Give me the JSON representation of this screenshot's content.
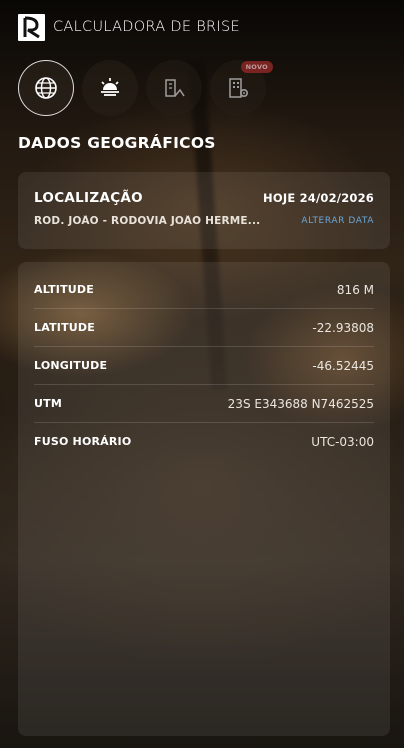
{
  "header": {
    "app_title": "CALCULADORA DE BRISE",
    "logo_icon": "brand-logo-icon"
  },
  "tabs": [
    {
      "name": "dados-geograficos",
      "icon": "globe-icon",
      "active": true
    },
    {
      "name": "sol",
      "icon": "sunrise-icon",
      "active": false
    },
    {
      "name": "fachada",
      "icon": "building-sun-icon",
      "active": false
    },
    {
      "name": "predio",
      "icon": "building-gear-icon",
      "active": false,
      "badge": "NOVO"
    }
  ],
  "section": {
    "title": "DADOS GEOGRÁFICOS"
  },
  "location": {
    "title": "LOCALIZAÇÃO",
    "date": "HOJE 24/02/2026",
    "address": "ROD. JOÃO - RODOVIA JOÃO HERME...",
    "change_date_link": "ALTERAR DATA"
  },
  "geo_data": {
    "rows": [
      {
        "label": "ALTITUDE",
        "value": "816 M"
      },
      {
        "label": "LATITUDE",
        "value": "-22.93808"
      },
      {
        "label": "LONGITUDE",
        "value": "-46.52445"
      },
      {
        "label": "UTM",
        "value": "23S E343688 N7462525"
      },
      {
        "label": "FUSO HORÁRIO",
        "value": "UTC-03:00"
      }
    ]
  },
  "colors": {
    "link": "#6aa6d8",
    "badge": "#9b2a2a"
  }
}
